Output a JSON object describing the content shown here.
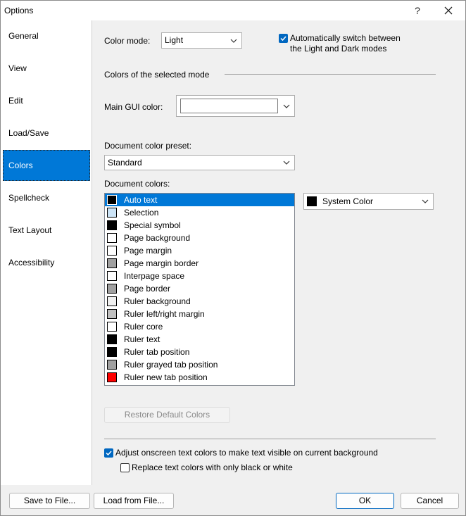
{
  "window": {
    "title": "Options",
    "help_glyph": "?",
    "close_glyph": "✕"
  },
  "sidebar": {
    "items": [
      {
        "label": "General"
      },
      {
        "label": "View"
      },
      {
        "label": "Edit"
      },
      {
        "label": "Load/Save"
      },
      {
        "label": "Colors",
        "selected": true
      },
      {
        "label": "Spellcheck"
      },
      {
        "label": "Text Layout"
      },
      {
        "label": "Accessibility"
      }
    ]
  },
  "colors": {
    "color_mode_label": "Color mode:",
    "color_mode_value": "Light",
    "auto_switch_label_line1": "Automatically switch between",
    "auto_switch_label_line2": "the Light and Dark modes",
    "auto_switch_checked": true,
    "selected_mode_heading": "Colors of the selected mode",
    "main_gui_label": "Main GUI color:",
    "main_gui_color": "#ffffff",
    "preset_label": "Document color preset:",
    "preset_value": "Standard",
    "doc_colors_label": "Document colors:",
    "doc_colors": [
      {
        "name": "Auto text",
        "color": "#000000",
        "selected": true
      },
      {
        "name": "Selection",
        "color": "#cce4f7"
      },
      {
        "name": "Special symbol",
        "color": "#000000"
      },
      {
        "name": "Page background",
        "color": "#ffffff"
      },
      {
        "name": "Page margin",
        "color": "#ffffff"
      },
      {
        "name": "Page margin border",
        "color": "#a0a0a0"
      },
      {
        "name": "Interpage space",
        "color": "#ffffff"
      },
      {
        "name": "Page border",
        "color": "#a0a0a0"
      },
      {
        "name": "Ruler background",
        "color": "#f0f0f0"
      },
      {
        "name": "Ruler left/right margin",
        "color": "#c0c0c0"
      },
      {
        "name": "Ruler core",
        "color": "#ffffff"
      },
      {
        "name": "Ruler text",
        "color": "#000000"
      },
      {
        "name": "Ruler tab position",
        "color": "#000000"
      },
      {
        "name": "Ruler grayed tab position",
        "color": "#a0a0a0"
      },
      {
        "name": "Ruler new tab position",
        "color": "#ff0000"
      }
    ],
    "selected_color_value": "System Color",
    "selected_color_swatch": "#000000",
    "restore_button": "Restore Default Colors",
    "adjust_label": "Adjust onscreen text colors to make text visible on current background",
    "adjust_checked": true,
    "replace_label": "Replace text colors with only black or white",
    "replace_checked": false
  },
  "footer": {
    "save_label": "Save to File...",
    "load_label": "Load from File...",
    "ok_label": "OK",
    "cancel_label": "Cancel"
  },
  "accent": "#0078d7"
}
